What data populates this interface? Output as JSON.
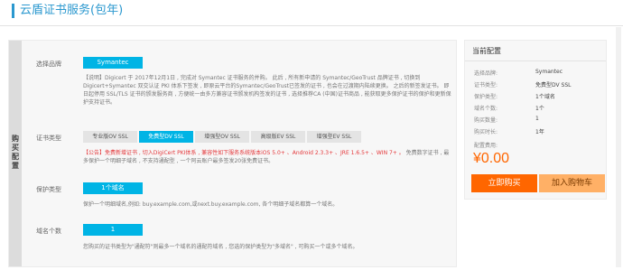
{
  "page": {
    "title": "云盾证书服务(包年)"
  },
  "vertical_tab": {
    "label": "购买配置"
  },
  "brand": {
    "label": "选择品牌",
    "selected": "Symantec",
    "notice": "【说明】Digicert 于 2017年12月1日 , 完成对 Symantec 证书服务的并购。 此后 , 所有新申请的 Symantec/GeoTrust 品牌证书 , 切换到 Digicert+Symantec 双交认证 PKI 体系下签发 , 即原云平台的Symantec/GeoTrust已签发的证书 , 也会在过渡期内陆续更换。 之后的新签发证书。",
    "notice2": "即日起停用 SSL/TLS 证书的颁发服务商 , 方便统一由多方兼容证书颁发机构签发的证书 , 选择推荐CA (中国)证书商品 , 能获取更多保护证书的保护和更新保护支持证书。"
  },
  "cert_type": {
    "label": "证书类型",
    "tabs": [
      "专业版OV SSL",
      "免费型DV SSL",
      "增强型OV SSL",
      "高级版EV SSL",
      "增强型EV SSL"
    ],
    "active_index": 1,
    "notice_red": "【公告】免费新增证书 , 切入DigiCert PKI体系 , 兼容性如下服务系统版本iOS 5.0+ 、Android 2.3.3+ 、JRE 1.6.5+ 、WIN 7+ 。",
    "notice_tail": "免费数字证书 , 最多保护一个明细子域名 , 不支持通配型 , 一个阿云账户最多签发20张免费证书。"
  },
  "protect_type": {
    "label": "保护类型",
    "selected": "1个域名",
    "notice": "保护一个明细域名,例如: buy.example.com,或next.buy.example.com, 各个明细子域名都算一个域名。"
  },
  "domain_count": {
    "label": "域名个数",
    "selected": "1",
    "notice": "您购买的证书类型为\"通配符\"则最多一个域名的通配符域名 , 您选的保护类型为\"多域名\" , 可购买一个或多个域名。"
  },
  "summary": {
    "title": "当前配置",
    "rows": [
      {
        "k": "选择品牌:",
        "v": "Symantec"
      },
      {
        "k": "证书类型:",
        "v": "免费型DV SSL"
      },
      {
        "k": "保护类型:",
        "v": "1个域名"
      },
      {
        "k": "域名个数:",
        "v": "1个"
      },
      {
        "k": "购买数量:",
        "v": "1"
      },
      {
        "k": "购买时长:",
        "v": "1年"
      }
    ],
    "fee_label": "配置费用:",
    "price": "¥0.00",
    "buy_label": "立即购买",
    "cart_label": "加入购物车"
  },
  "colors": {
    "accent": "#00b4e5",
    "orange": "#ff6600",
    "title_blue": "#2b98cf",
    "notice_red": "#e4393c"
  }
}
